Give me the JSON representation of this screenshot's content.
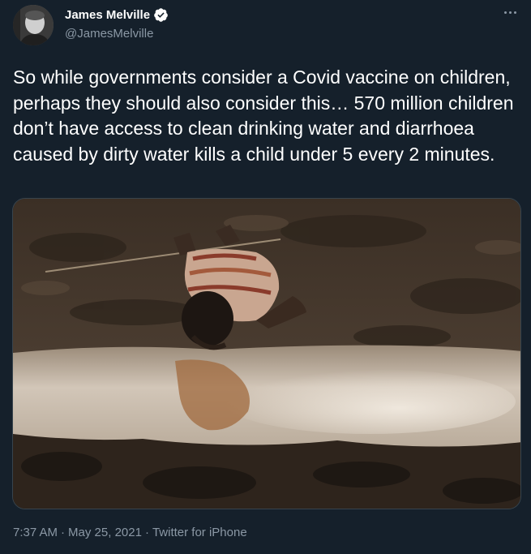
{
  "author": {
    "display_name": "James Melville",
    "handle": "@JamesMelville",
    "verified": true,
    "avatar_icon": "profile-photo"
  },
  "more_menu_icon": "ellipsis-icon",
  "tweet": {
    "text": "So while governments consider a Covid vaccine on children, perhaps they should also consider this… 570 million children don’t have access to clean drinking water and diarrhoea caused by dirty water kills a child under 5 every 2 minutes."
  },
  "media": {
    "type": "photo"
  },
  "meta": {
    "time": "7:37 AM",
    "separator1": "·",
    "date": "May 25, 2021",
    "separator2": "·",
    "source": "Twitter for iPhone"
  },
  "colors": {
    "background": "#15202b",
    "text_primary": "#ffffff",
    "text_secondary": "#8b98a5",
    "verified_blue": "#ffffff",
    "border": "#38444d"
  }
}
